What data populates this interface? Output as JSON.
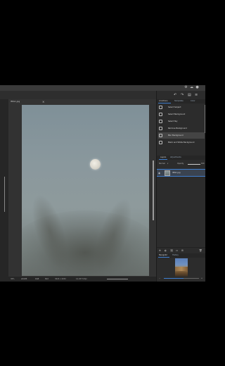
{
  "document": {
    "tab_name": "IMG1.jpg",
    "close_glyph": "×"
  },
  "topbar_icons": [
    "gear-icon",
    "cloud-icon",
    "user-icon"
  ],
  "panel_icons": {
    "undo": "↶",
    "redo": "↷",
    "save": "▤",
    "menu": "≡"
  },
  "right_panel": {
    "top_tabs": [
      {
        "label": "AI Actions",
        "active": true
      },
      {
        "label": "Templates",
        "active": false
      },
      {
        "label": "Color",
        "active": false
      }
    ],
    "ai_actions": [
      {
        "label": "Select Subject",
        "icon": "select-subject-icon",
        "selected": false
      },
      {
        "label": "Select Background",
        "icon": "select-background-icon",
        "selected": false
      },
      {
        "label": "Select Sky",
        "icon": "select-sky-icon",
        "selected": false
      },
      {
        "label": "Remove Background",
        "icon": "remove-background-icon",
        "selected": false
      },
      {
        "label": "Blur Background",
        "icon": "blur-background-icon",
        "selected": true
      },
      {
        "label": "Black and White Background",
        "icon": "bw-background-icon",
        "selected": false
      }
    ],
    "layer_tabs": [
      {
        "label": "Layers",
        "active": true
      },
      {
        "label": "Adjustments",
        "active": false
      }
    ],
    "layer_controls": {
      "blend_mode": "Normal",
      "opacity_label": "Opacity",
      "opacity_value": "100",
      "opacity_fraction": 1.0
    },
    "layers": [
      {
        "name": "IMG1.jpg",
        "visible": true
      }
    ],
    "layer_tool_glyphs": [
      "⊕",
      "◐",
      "⛓",
      "▭",
      "⊞",
      "🗑"
    ],
    "nav_tabs": [
      {
        "label": "Navigator",
        "active": true
      },
      {
        "label": "History",
        "active": false
      }
    ],
    "navigator": {
      "zoom_min": "−",
      "zoom_max": "+",
      "zoom_fraction": 0.55
    }
  },
  "status_bar": {
    "zoom": "30%",
    "mode": "sRGB8",
    "info1": "RGB",
    "info2": "8bit",
    "size": "3024 x 4032",
    "extra": "12.2M 72dpi"
  }
}
